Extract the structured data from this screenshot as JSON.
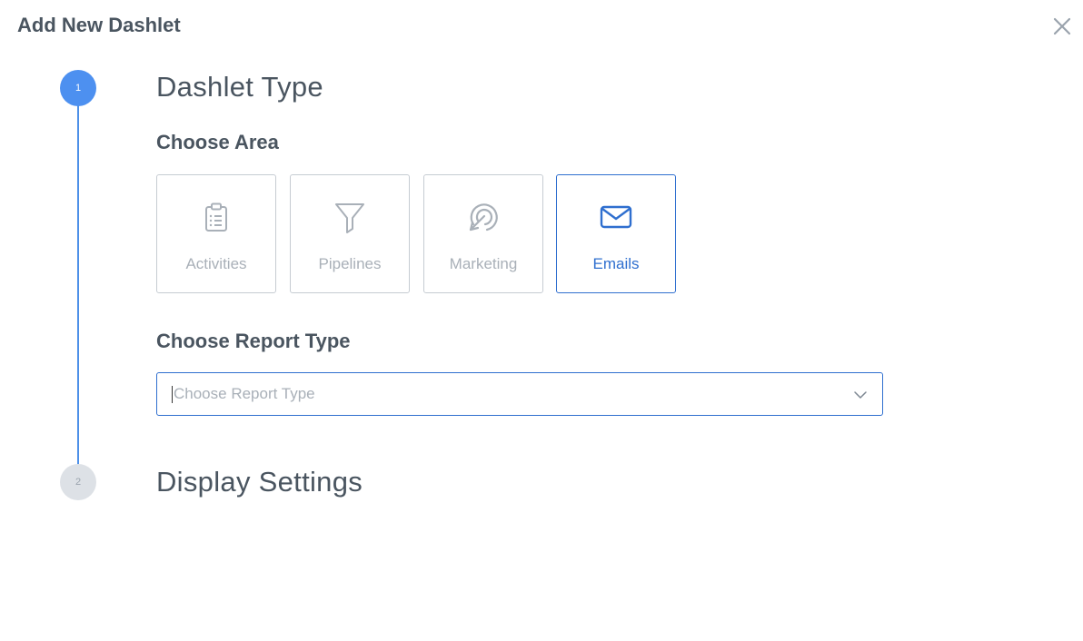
{
  "modal": {
    "title": "Add New Dashlet",
    "close_icon": "close-icon"
  },
  "steps": [
    {
      "number": "1",
      "title": "Dashlet Type",
      "state": "active"
    },
    {
      "number": "2",
      "title": "Display Settings",
      "state": "inactive"
    }
  ],
  "choose_area": {
    "label": "Choose Area",
    "options": [
      {
        "label": "Activities",
        "icon": "clipboard-icon",
        "selected": false
      },
      {
        "label": "Pipelines",
        "icon": "funnel-icon",
        "selected": false
      },
      {
        "label": "Marketing",
        "icon": "target-icon",
        "selected": false
      },
      {
        "label": "Emails",
        "icon": "envelope-icon",
        "selected": true
      }
    ]
  },
  "report_type": {
    "label": "Choose Report Type",
    "placeholder": "Choose Report Type",
    "value": ""
  },
  "colors": {
    "accent": "#2f6fcf",
    "step_active": "#4d90f0",
    "step_inactive": "#dde1e6",
    "text": "#4a5560",
    "muted": "#a9b0b8"
  }
}
